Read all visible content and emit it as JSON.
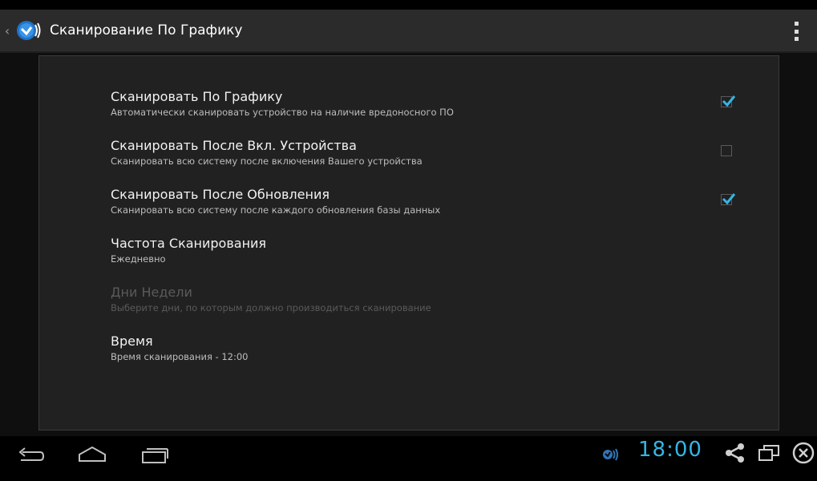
{
  "action_bar": {
    "title": "Сканирование По Графику"
  },
  "preferences": [
    {
      "title": "Сканировать По Графику",
      "summary": "Автоматически сканировать устройство на наличие вредоносного ПО",
      "checked": true,
      "has_checkbox": true,
      "enabled": true
    },
    {
      "title": "Сканировать После Вкл. Устройства",
      "summary": "Сканировать всю систему после включения Вашего устройства",
      "checked": false,
      "has_checkbox": true,
      "enabled": true
    },
    {
      "title": "Сканировать После Обновления",
      "summary": "Сканировать всю систему после каждого обновления базы данных",
      "checked": true,
      "has_checkbox": true,
      "enabled": true
    },
    {
      "title": "Частота Сканирования",
      "summary": "Ежедневно",
      "has_checkbox": false,
      "enabled": true
    },
    {
      "title": "Дни Недели",
      "summary": "Выберите дни, по которым должно производиться сканирование",
      "has_checkbox": false,
      "enabled": false
    },
    {
      "title": "Время",
      "summary": "Время сканирования - 12:00",
      "has_checkbox": false,
      "enabled": true
    }
  ],
  "system_bar": {
    "clock": "18:00"
  },
  "colors": {
    "accent": "#33b5e5",
    "action_bar": "#2b2b2b",
    "panel": "#212121"
  }
}
